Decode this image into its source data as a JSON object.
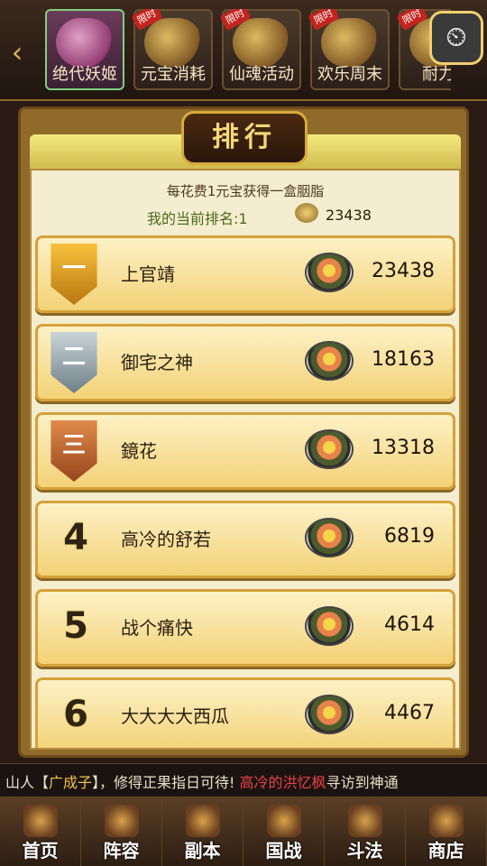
{
  "tabs": [
    {
      "label": "绝代妖姬",
      "badge": "",
      "active": true
    },
    {
      "label": "元宝消耗",
      "badge": "限时",
      "active": false
    },
    {
      "label": "仙魂活动",
      "badge": "限时",
      "active": false
    },
    {
      "label": "欢乐周末",
      "badge": "限时",
      "active": false
    },
    {
      "label": "耐力",
      "badge": "限时",
      "active": false
    }
  ],
  "panel": {
    "title": "排行",
    "subtitle": "每花费1元宝获得一盒胭脂",
    "my_rank_label": "我的当前排名:1",
    "my_score": "23438"
  },
  "ranking": [
    {
      "rank": "一",
      "name": "上官靖",
      "score": "23438",
      "medal": "gold"
    },
    {
      "rank": "二",
      "name": "御宅之神",
      "score": "18163",
      "medal": "silver"
    },
    {
      "rank": "三",
      "name": "鏡花",
      "score": "13318",
      "medal": "bronze"
    },
    {
      "rank": "4",
      "name": "高冷的舒若",
      "score": "6819",
      "medal": ""
    },
    {
      "rank": "5",
      "name": "战个痛快",
      "score": "4614",
      "medal": ""
    },
    {
      "rank": "6",
      "name": "大大大大西瓜",
      "score": "4467",
      "medal": ""
    }
  ],
  "ticker": {
    "part1": "山人【",
    "part2": "广成子",
    "part3": "】，修得正果指日可待! ",
    "part4": "高冷的洪忆枫",
    "part5": "寻访到神通"
  },
  "bottom_nav": [
    {
      "label": "首页"
    },
    {
      "label": "阵容"
    },
    {
      "label": "副本"
    },
    {
      "label": "国战"
    },
    {
      "label": "斗法"
    },
    {
      "label": "商店"
    }
  ]
}
